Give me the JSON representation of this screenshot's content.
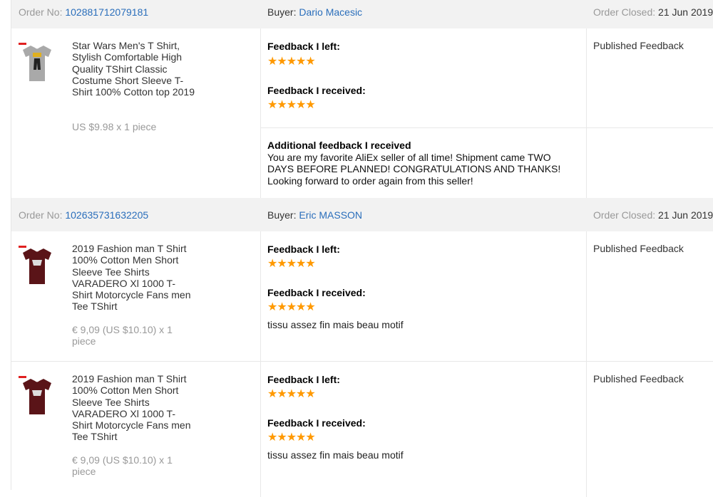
{
  "labels": {
    "order_no": "Order No:",
    "buyer": "Buyer:",
    "order_closed": "Order Closed:",
    "feedback_left": "Feedback I left:",
    "feedback_received": "Feedback I received:",
    "additional_feedback": "Additional feedback I received",
    "status": "Published Feedback",
    "stars": "★★★★★"
  },
  "orders": [
    {
      "order_no": "102881712079181",
      "buyer": "Dario Macesic",
      "closed": "21 Jun 2019",
      "items": [
        {
          "title": "Star Wars Men's T Shirt, Stylish Comfortable High Quality TShirt Classic Costume Short Sleeve T-Shirt 100% Cotton top 2019",
          "price": "US $9.98 x 1 piece",
          "shirt_color": "#a9a9a9",
          "comment": "",
          "additional": "You are my favorite AliEx seller of all time! Shipment came TWO DAYS BEFORE PLANNED! CONGRATULATIONS AND THANKS! Looking forward to order again from this seller!"
        }
      ]
    },
    {
      "order_no": "102635731632205",
      "buyer": "Eric MASSON",
      "closed": "21 Jun 2019",
      "items": [
        {
          "title": "2019 Fashion man T Shirt 100% Cotton Men Short Sleeve Tee Shirts VARADERO Xl 1000 T-Shirt Motorcycle Fans men Tee TShirt",
          "price": "€ 9,09 (US $10.10) x 1 piece",
          "shirt_color": "#5a1418",
          "comment": "tissu assez fin mais beau motif"
        },
        {
          "title": "2019 Fashion man T Shirt 100% Cotton Men Short Sleeve Tee Shirts VARADERO Xl 1000 T-Shirt Motorcycle Fans men Tee TShirt",
          "price": "€ 9,09 (US $10.10) x 1 piece",
          "shirt_color": "#5a1418",
          "comment": "tissu assez fin mais beau motif"
        }
      ]
    }
  ],
  "colors": {
    "star": "#ff9900",
    "link": "#2a6ebb",
    "header_bg": "#f2f2f2"
  }
}
